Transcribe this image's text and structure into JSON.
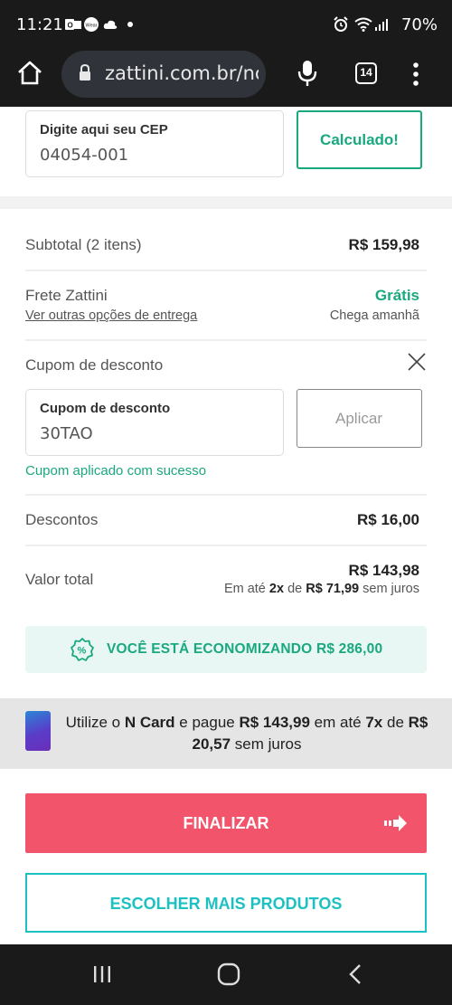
{
  "status_bar": {
    "time": "11:21",
    "icons_left": [
      "outlook-icon",
      "wear-icon",
      "cloud-icon",
      "dot-icon"
    ],
    "battery": "70%"
  },
  "browser": {
    "url": "zattini.com.br/nc",
    "tab_count": "14"
  },
  "cep": {
    "label": "Digite aqui seu CEP",
    "value": "04054-001",
    "button": "Calculado!"
  },
  "summary": {
    "subtotal_label": "Subtotal (2 itens)",
    "subtotal_value": "R$ 159,98",
    "frete_label": "Frete Zattini",
    "frete_link": "Ver outras opções de entrega",
    "frete_value": "Grátis",
    "frete_eta": "Chega amanhã",
    "coupon_title": "Cupom de desconto",
    "coupon_label": "Cupom de desconto",
    "coupon_value": "30TAO",
    "coupon_button": "Aplicar",
    "coupon_success": "Cupom aplicado com sucesso",
    "descontos_label": "Descontos",
    "descontos_value": "R$ 16,00",
    "total_label": "Valor total",
    "total_value": "R$ 143,98",
    "installments_prefix": "Em até",
    "installments_count": "2x",
    "installments_mid": "de",
    "installments_amount": "R$ 71,99",
    "installments_suffix": "sem juros"
  },
  "savings": {
    "text": "VOCÊ ESTÁ ECONOMIZANDO R$ 286,00"
  },
  "ncard": {
    "t1": "Utilize o ",
    "t2": "N Card",
    "t3": " e pague ",
    "t4": "R$ 143,99",
    "t5": " em até ",
    "t6": "7x",
    "t7": " de ",
    "t8": "R$ 20,57",
    "t9": " sem juros"
  },
  "actions": {
    "finalizar": "FINALIZAR",
    "escolher": "ESCOLHER MAIS PRODUTOS"
  },
  "colors": {
    "green": "#1aa87f",
    "red": "#f2546b",
    "teal": "#1ec1c1"
  }
}
